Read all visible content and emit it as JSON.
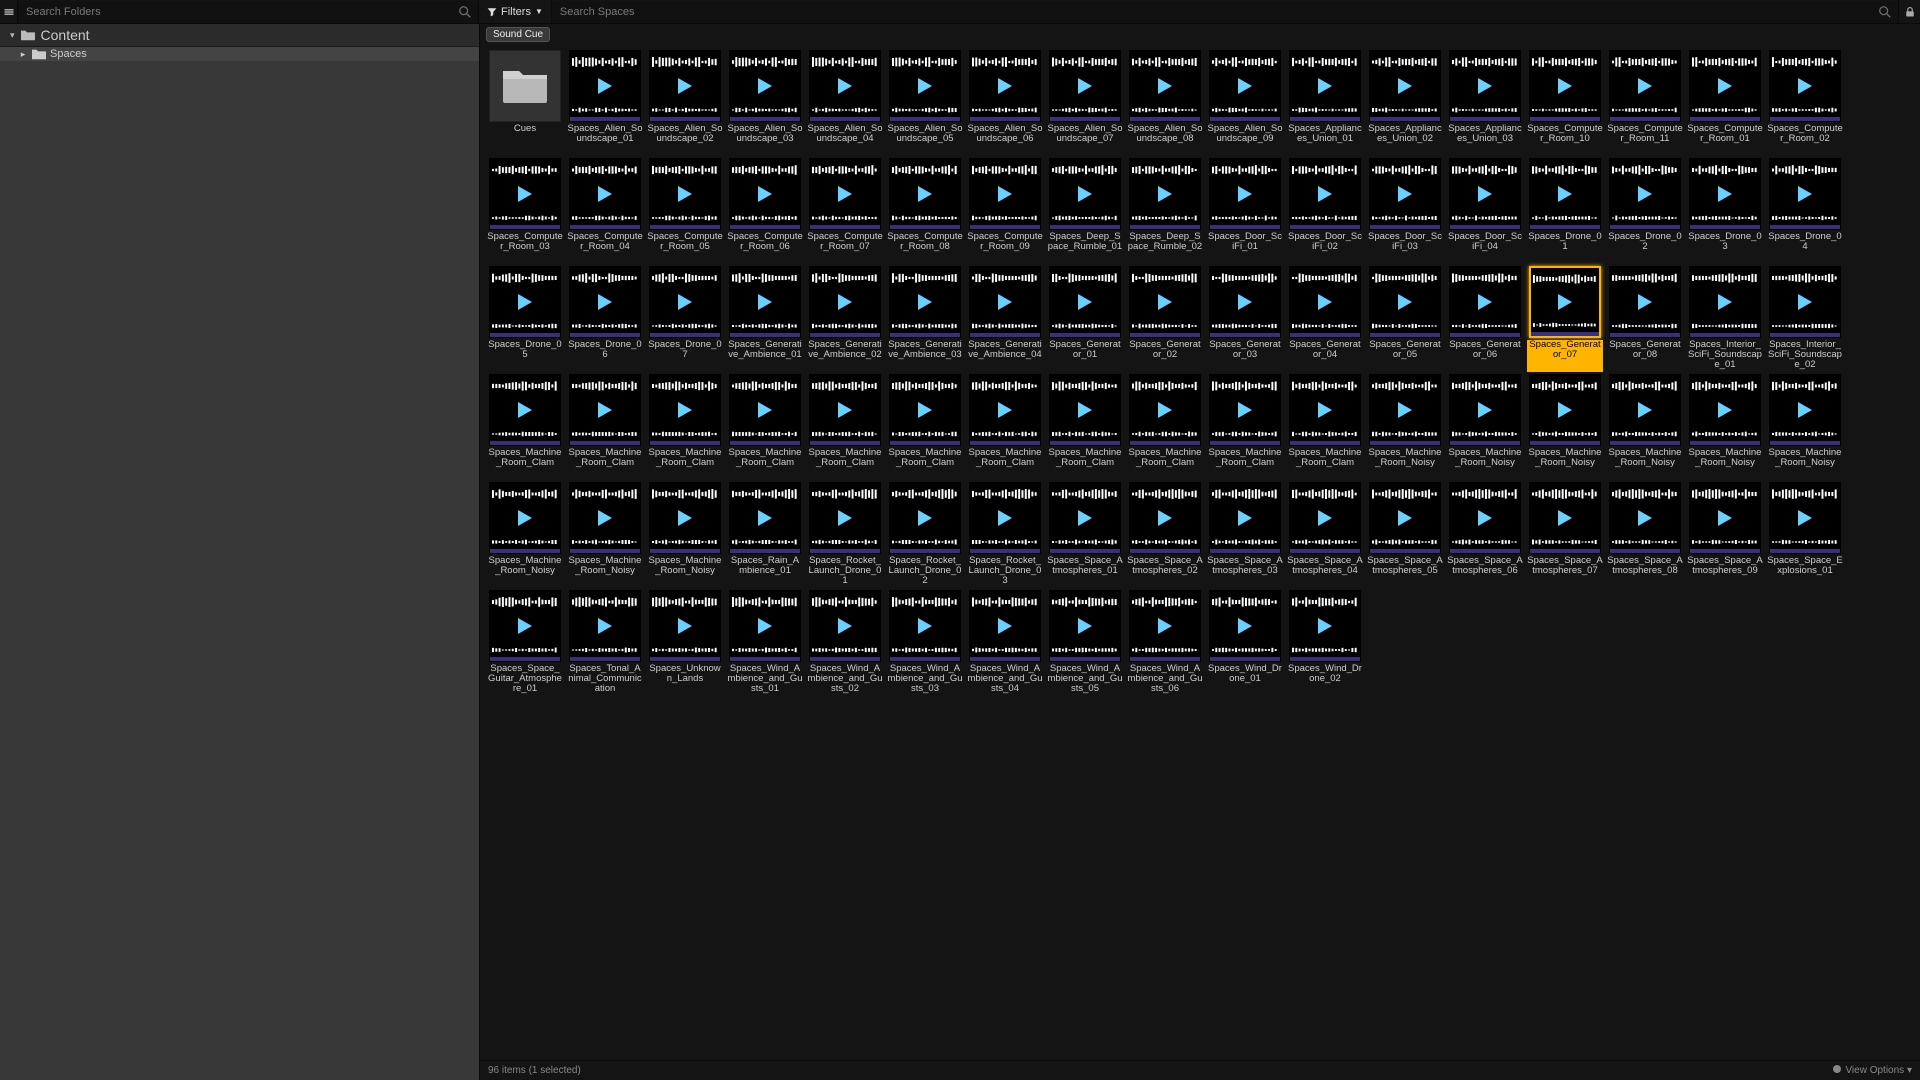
{
  "search_folders_placeholder": "Search Folders",
  "search_spaces_placeholder": "Search Spaces",
  "filters_label": "Filters",
  "content_root_label": "Content",
  "tree_folder_label": "Spaces",
  "breadcrumb_tag": "Sound Cue",
  "status_left": "96 items (1 selected)",
  "view_options_label": "View Options",
  "selected_index": 46,
  "folder_item_label": "Cues",
  "assets": [
    "Spaces_Alien_Soundscape_01",
    "Spaces_Alien_Soundscape_02",
    "Spaces_Alien_Soundscape_03",
    "Spaces_Alien_Soundscape_04",
    "Spaces_Alien_Soundscape_05",
    "Spaces_Alien_Soundscape_06",
    "Spaces_Alien_Soundscape_07",
    "Spaces_Alien_Soundscape_08",
    "Spaces_Alien_Soundscape_09",
    "Spaces_Appliances_Union_01",
    "Spaces_Appliances_Union_02",
    "Spaces_Appliances_Union_03",
    "Spaces_Computer_Room_10",
    "Spaces_Computer_Room_11",
    "Spaces_Computer_Room_01",
    "Spaces_Computer_Room_02",
    "Spaces_Computer_Room_03",
    "Spaces_Computer_Room_04",
    "Spaces_Computer_Room_05",
    "Spaces_Computer_Room_06",
    "Spaces_Computer_Room_07",
    "Spaces_Computer_Room_08",
    "Spaces_Computer_Room_09",
    "Spaces_Deep_Space_Rumble_01",
    "Spaces_Deep_Space_Rumble_02",
    "Spaces_Door_SciFi_01",
    "Spaces_Door_SciFi_02",
    "Spaces_Door_SciFi_03",
    "Spaces_Door_SciFi_04",
    "Spaces_Drone_01",
    "Spaces_Drone_02",
    "Spaces_Drone_03",
    "Spaces_Drone_04",
    "Spaces_Drone_05",
    "Spaces_Drone_06",
    "Spaces_Drone_07",
    "Spaces_Generative_Ambience_01",
    "Spaces_Generative_Ambience_02",
    "Spaces_Generative_Ambience_03",
    "Spaces_Generative_Ambience_04",
    "Spaces_Generator_01",
    "Spaces_Generator_02",
    "Spaces_Generator_03",
    "Spaces_Generator_04",
    "Spaces_Generator_05",
    "Spaces_Generator_06",
    "Spaces_Generator_07",
    "Spaces_Generator_08",
    "Spaces_Interior_SciFi_Soundscape_01",
    "Spaces_Interior_SciFi_Soundscape_02",
    "Spaces_Machine_Room_Clam",
    "Spaces_Machine_Room_Clam",
    "Spaces_Machine_Room_Clam",
    "Spaces_Machine_Room_Clam",
    "Spaces_Machine_Room_Clam",
    "Spaces_Machine_Room_Clam",
    "Spaces_Machine_Room_Clam",
    "Spaces_Machine_Room_Clam",
    "Spaces_Machine_Room_Clam",
    "Spaces_Machine_Room_Clam",
    "Spaces_Machine_Room_Clam",
    "Spaces_Machine_Room_Noisy",
    "Spaces_Machine_Room_Noisy",
    "Spaces_Machine_Room_Noisy",
    "Spaces_Machine_Room_Noisy",
    "Spaces_Machine_Room_Noisy",
    "Spaces_Machine_Room_Noisy",
    "Spaces_Machine_Room_Noisy",
    "Spaces_Machine_Room_Noisy",
    "Spaces_Machine_Room_Noisy",
    "Spaces_Rain_Ambience_01",
    "Spaces_Rocket_Launch_Drone_01",
    "Spaces_Rocket_Launch_Drone_02",
    "Spaces_Rocket_Launch_Drone_03",
    "Spaces_Space_Atmospheres_01",
    "Spaces_Space_Atmospheres_02",
    "Spaces_Space_Atmospheres_03",
    "Spaces_Space_Atmospheres_04",
    "Spaces_Space_Atmospheres_05",
    "Spaces_Space_Atmospheres_06",
    "Spaces_Space_Atmospheres_07",
    "Spaces_Space_Atmospheres_08",
    "Spaces_Space_Atmospheres_09",
    "Spaces_Space_Explosions_01",
    "Spaces_Space_Guitar_Atmosphere_01",
    "Spaces_Tonal_Animal_Communication",
    "Spaces_Unknown_Lands",
    "Spaces_Wind_Ambience_and_Gusts_01",
    "Spaces_Wind_Ambience_and_Gusts_02",
    "Spaces_Wind_Ambience_and_Gusts_03",
    "Spaces_Wind_Ambience_and_Gusts_04",
    "Spaces_Wind_Ambience_and_Gusts_05",
    "Spaces_Wind_Ambience_and_Gusts_06",
    "Spaces_Wind_Drone_01",
    "Spaces_Wind_Drone_02"
  ]
}
